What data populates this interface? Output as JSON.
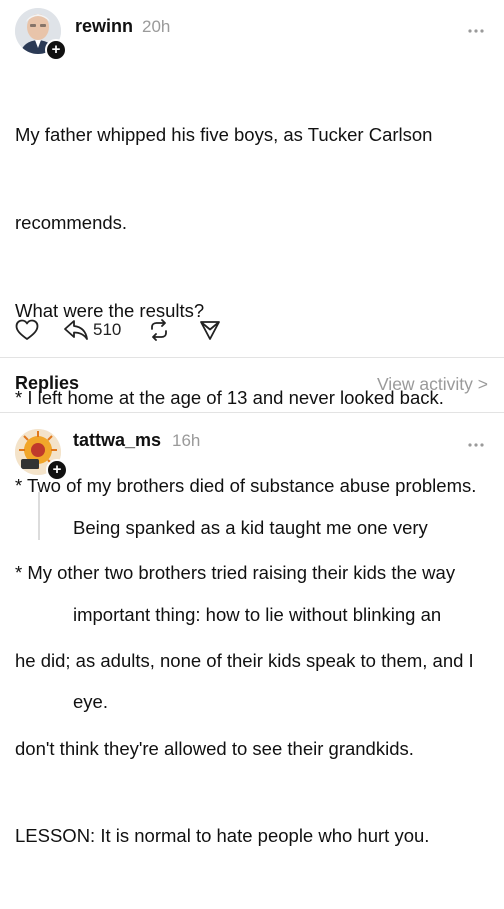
{
  "post": {
    "username": "rewinn",
    "time": "20h",
    "lines": [
      "My father whipped his five boys, as Tucker Carlson",
      "recommends.",
      "What were the results?",
      "* I left home at the age of 13 and never looked back.",
      "* Two of my brothers died of substance abuse problems.",
      "* My other two brothers tried raising their kids the way",
      "he did; as adults, none of their kids speak to them, and I",
      "don't think they're allowed to see their grandkids.",
      "LESSON: It is normal to hate people who hurt you."
    ],
    "actions": {
      "like_icon": "heart-icon",
      "reply_icon": "reply-icon",
      "reply_count": "510",
      "repost_icon": "repost-icon",
      "share_icon": "send-icon"
    },
    "more_icon": "more-dots-icon",
    "follow_symbol": "+"
  },
  "replies_section": {
    "title": "Replies",
    "view_activity": "View activity >"
  },
  "reply": {
    "username": "tattwa_ms",
    "time": "16h",
    "lines": [
      "Being spanked as a kid taught me one very",
      "important thing: how to lie without blinking an",
      "eye."
    ],
    "more_icon": "more-dots-icon",
    "follow_symbol": "+"
  },
  "colors": {
    "text": "#111111",
    "muted": "#9a9a9a",
    "divider": "#e3e3e3"
  }
}
